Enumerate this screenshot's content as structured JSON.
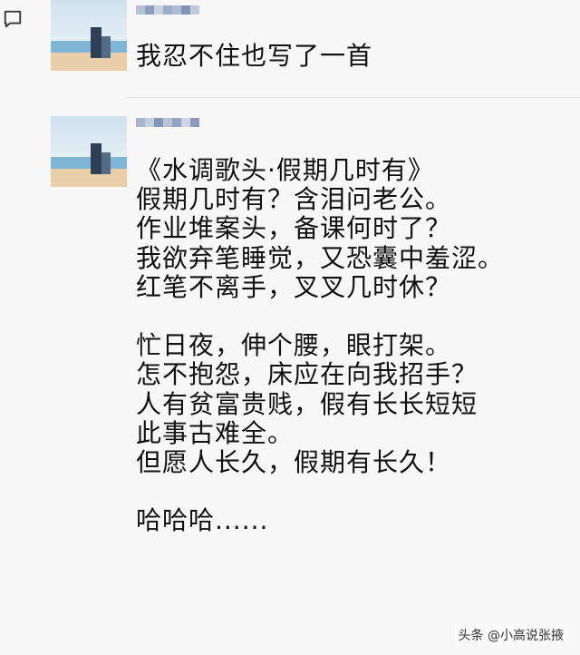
{
  "posts": [
    {
      "message": "我忍不住也写了一首"
    },
    {
      "message_lines": [
        "《水调歌头·假期几时有》",
        "假期几时有？含泪问老公。",
        "作业堆案头，备课何时了？",
        "我欲弃笔睡觉，又恐囊中羞涩。",
        "红笔不离手，叉叉几时休？",
        "",
        "忙日夜，伸个腰，眼打架。",
        "怎不抱怨，床应在向我招手？",
        "人有贫富贵贱，假有长长短短",
        "此事古难全。",
        "但愿人长久，假期有长久！",
        "",
        "哈哈哈......"
      ]
    }
  ],
  "watermark": "头条 @小高说张掖",
  "icons": {
    "comment": "comment-icon"
  }
}
